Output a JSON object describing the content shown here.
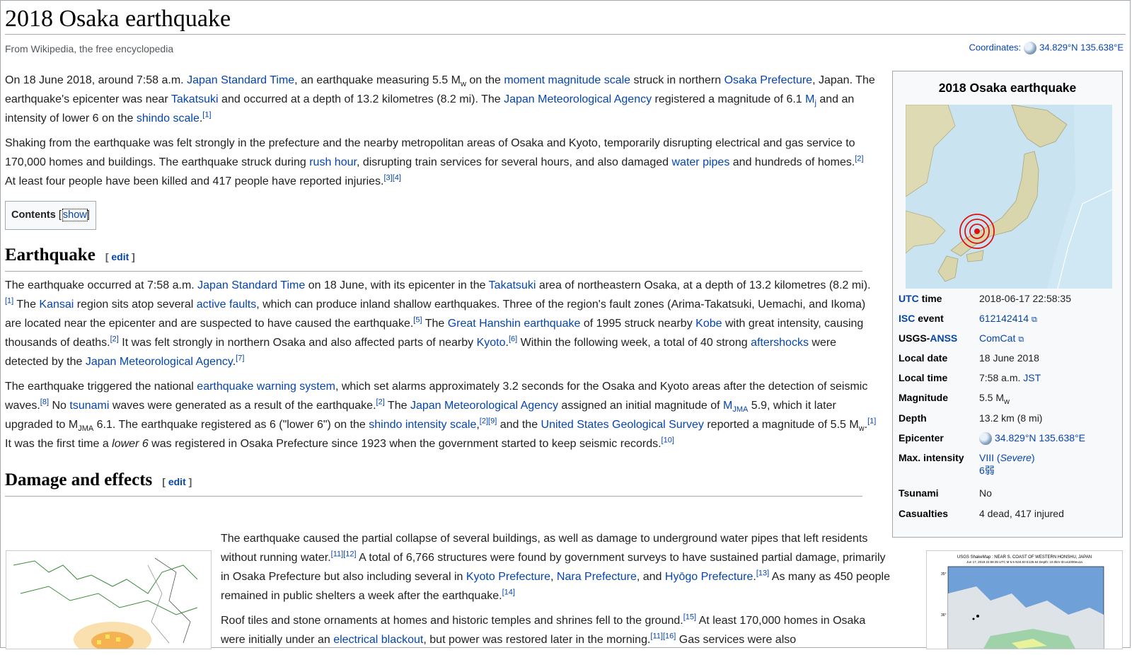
{
  "page": {
    "title": "2018 Osaka earthquake",
    "tagline": "From Wikipedia, the free encyclopedia",
    "coordinates_label": "Coordinates:",
    "coordinates_value": "34.829°N 135.638°E"
  },
  "intro": {
    "p1": {
      "a": "On 18 June 2018, around 7:58 a.m. ",
      "l1": "Japan Standard Time",
      "b": ", an earthquake measuring 5.5 M",
      "sub1": "w",
      "c": " on the ",
      "l2": "moment magnitude scale",
      "d": " struck in northern ",
      "l3": "Osaka Prefecture",
      "e": ", Japan. The earthquake's epicenter was near ",
      "l4": "Takatsuki",
      "f": " and occurred at a depth of 13.2 kilometres (8.2 mi). The ",
      "l5": "Japan Meteorological Agency",
      "g": " registered a magnitude of 6.1 ",
      "l6": "M",
      "sub2": "j",
      "h": " and an intensity of lower 6 on the ",
      "l7": "shindo scale",
      "i": ".",
      "ref1": "[1]"
    },
    "p2": {
      "a": "Shaking from the earthquake was felt strongly in the prefecture and the nearby metropolitan areas of Osaka and Kyoto, temporarily disrupting electrical and gas service to 170,000 homes and buildings. The earthquake struck during ",
      "l1": "rush hour",
      "b": ", disrupting train services for several hours, and also damaged ",
      "l2": "water pipes",
      "c": " and hundreds of homes.",
      "ref1": "[2]",
      "d": " At least four people have been killed and 417 people have reported injuries.",
      "ref2": "[3]",
      "ref3": "[4]"
    }
  },
  "toc": {
    "label": "Contents",
    "toggle": "show"
  },
  "sections": {
    "earthquake": {
      "heading": "Earthquake",
      "edit": "edit",
      "p1": {
        "a": "The earthquake occurred at 7:58 a.m. ",
        "l1": "Japan Standard Time",
        "b": " on 18 June, with its epicenter in the ",
        "l2": "Takatsuki",
        "c": " area of northeastern Osaka, at a depth of 13.2 kilometres (8.2 mi).",
        "r1": "[1]",
        "d": " The ",
        "l3": "Kansai",
        "e": " region sits atop several ",
        "l4": "active faults",
        "f": ", which can produce inland shallow earthquakes. Three of the region's fault zones (Arima-Takatsuki, Uemachi, and Ikoma) are located near the epicenter and are suspected to have caused the earthquake.",
        "r2": "[5]",
        "g": " The ",
        "l5": "Great Hanshin earthquake",
        "h": " of 1995 struck nearby ",
        "l6": "Kobe",
        "i": " with great intensity, causing thousands of deaths.",
        "r3": "[2]",
        "j": " It was felt strongly in northern Osaka and also affected parts of nearby ",
        "l7": "Kyoto",
        "k": ".",
        "r4": "[6]",
        "l": " Within the following week, a total of 40 strong ",
        "l8": "aftershocks",
        "m": " were detected by the ",
        "l9": "Japan Meteorological Agency",
        "n": ".",
        "r5": "[7]"
      },
      "p2": {
        "a": "The earthquake triggered the national ",
        "l1": "earthquake warning system",
        "b": ", which set alarms approximately 3.2 seconds for the Osaka and Kyoto areas after the detection of seismic waves.",
        "r1": "[8]",
        "c": " No ",
        "l2": "tsunami",
        "d": " waves were generated as a result of the earthquake.",
        "r2": "[2]",
        "e": " The ",
        "l3": "Japan Meteorological Agency",
        "f": " assigned an initial magnitude of ",
        "l4": "M",
        "s1": "JMA",
        "g": " 5.9, which it later upgraded to M",
        "s2": "JMA",
        "h": " 6.1. The earthquake registered as 6 (\"lower 6\") on the ",
        "l5": "shindo intensity scale",
        "i": ",",
        "r3": "[2]",
        "r4": "[9]",
        "j": " and the ",
        "l6": "United States Geological Survey",
        "k": " reported a magnitude of 5.5 M",
        "s3": "w",
        "l": ".",
        "r5": "[1]",
        "m": " It was the first time a ",
        "em": "lower 6",
        "n": " was registered in Osaka Prefecture since 1923 when the government started to keep seismic records.",
        "r6": "[10]"
      }
    },
    "damage": {
      "heading": "Damage and effects",
      "edit": "edit",
      "p1": {
        "a": "The earthquake caused the partial collapse of several buildings, as well as damage to underground water pipes that left residents without running water.",
        "r1": "[11]",
        "r2": "[12]",
        "b": " A total of 6,766 structures were found by government surveys to have sustained partial damage, primarily in Osaka Prefecture but also including several in ",
        "l1": "Kyoto Prefecture",
        "c": ", ",
        "l2": "Nara Prefecture",
        "d": ", and ",
        "l3": "Hyōgo Prefecture",
        "e": ".",
        "r3": "[13]",
        "f": " As many as 450 people remained in public shelters a week after the earthquake.",
        "r4": "[14]"
      },
      "p2": {
        "a": "Roof tiles and stone ornaments at homes and historic temples and shrines fell to the ground.",
        "r1": "[15]",
        "b": " At least 170,000 homes in Osaka were initially under an ",
        "l1": "electrical blackout",
        "c": ", but power was restored later in the morning.",
        "r2": "[11]",
        "r3": "[16]",
        "d": " Gas services were also"
      }
    }
  },
  "infobox": {
    "title": "2018 Osaka earthquake",
    "rows": {
      "utc": {
        "key": "UTC",
        "key2": " time",
        "value": "2018-06-17 22:58:35"
      },
      "isc": {
        "key": "ISC",
        "key2": " event",
        "value": "612142414"
      },
      "usgs": {
        "key": "USGS-",
        "key2": "ANSS",
        "value": "ComCat"
      },
      "local_date": {
        "key": "Local date",
        "value": "18 June 2018"
      },
      "local_time": {
        "key": "Local time",
        "value": "7:58 a.m. ",
        "value_link": "JST"
      },
      "magnitude": {
        "key": "Magnitude",
        "value": "5.5 M",
        "sub": "w"
      },
      "depth": {
        "key": "Depth",
        "value": "13.2 km (8 mi)"
      },
      "epicenter": {
        "key": "Epicenter",
        "value": "34.829°N 135.638°E"
      },
      "max_intensity": {
        "key": "Max. intensity",
        "value": "VIII (",
        "value_em": "Severe",
        "value_end": ")",
        "value2": "6弱"
      },
      "tsunami": {
        "key": "Tsunami",
        "value": "No"
      },
      "casualties": {
        "key": "Casualties",
        "value": "4 dead, 417 injured"
      }
    }
  },
  "shakemap": {
    "header": "USGS ShakeMap : NEAR S. COAST OF WESTERN HONSHU, JAPAN",
    "subheader": "Jun 17, 2018 22:58:35 UTC  M 5.5  N34.83 E135.64  Depth: 10.0km  ID:us1000eu1a",
    "lat1": "35°",
    "lat2": "36°"
  },
  "colors": {
    "link": "#0645ad",
    "border": "#a2a9b1",
    "infobox_bg": "#f8f9fa",
    "epicenter": "#d11"
  }
}
